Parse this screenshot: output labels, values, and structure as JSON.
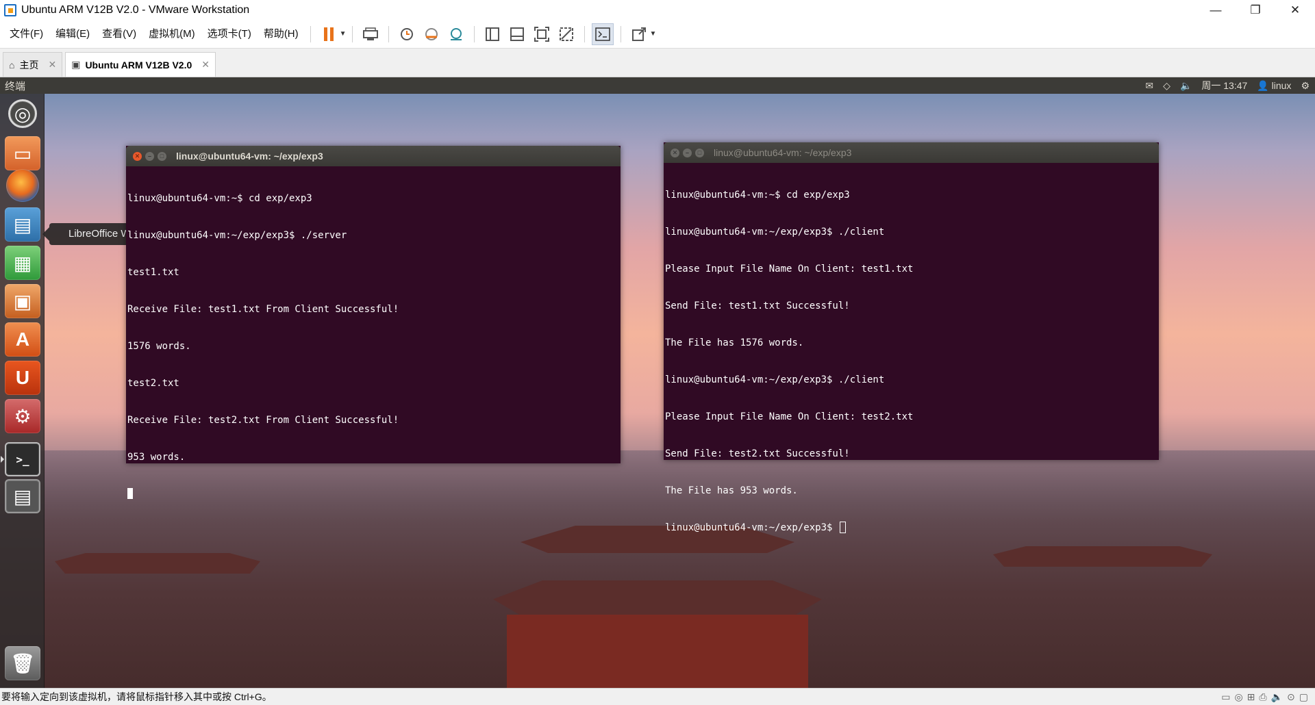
{
  "window": {
    "title": "Ubuntu ARM V12B V2.0 - VMware Workstation",
    "minimize": "—",
    "restore": "❐",
    "close": "✕"
  },
  "menu": {
    "items": [
      "文件(F)",
      "编辑(E)",
      "查看(V)",
      "虚拟机(M)",
      "选项卡(T)",
      "帮助(H)"
    ]
  },
  "toolbar": {
    "accent_color": "#e8731a"
  },
  "tabs": [
    {
      "label": "主页",
      "icon": "home-icon",
      "active": false
    },
    {
      "label": "Ubuntu ARM V12B V2.0",
      "icon": "vm-icon",
      "active": true
    }
  ],
  "guest": {
    "panel": {
      "title": "终端",
      "clock": "周一 13:47",
      "user": "linux"
    },
    "tooltip": "LibreOffice Writer",
    "terminal_left": {
      "title": "linux@ubuntu64-vm: ~/exp/exp3",
      "lines": [
        "linux@ubuntu64-vm:~$ cd exp/exp3",
        "linux@ubuntu64-vm:~/exp/exp3$ ./server",
        "test1.txt",
        "Receive File: test1.txt From Client Successful!",
        "1576 words.",
        "test2.txt",
        "Receive File: test2.txt From Client Successful!",
        "953 words."
      ]
    },
    "terminal_right": {
      "title": "linux@ubuntu64-vm: ~/exp/exp3",
      "lines": [
        "linux@ubuntu64-vm:~$ cd exp/exp3",
        "linux@ubuntu64-vm:~/exp/exp3$ ./client",
        "Please Input File Name On Client: test1.txt",
        "Send File: test1.txt Successful!",
        "The File has 1576 words.",
        "linux@ubuntu64-vm:~/exp/exp3$ ./client",
        "Please Input File Name On Client: test2.txt",
        "Send File: test2.txt Successful!",
        "The File has 953 words.",
        "linux@ubuntu64-vm:~/exp/exp3$ "
      ]
    },
    "terminal_bg": "#300a24"
  },
  "statusbar": {
    "text": "要将输入定向到该虚拟机，请将鼠标指针移入其中或按 Ctrl+G。"
  }
}
